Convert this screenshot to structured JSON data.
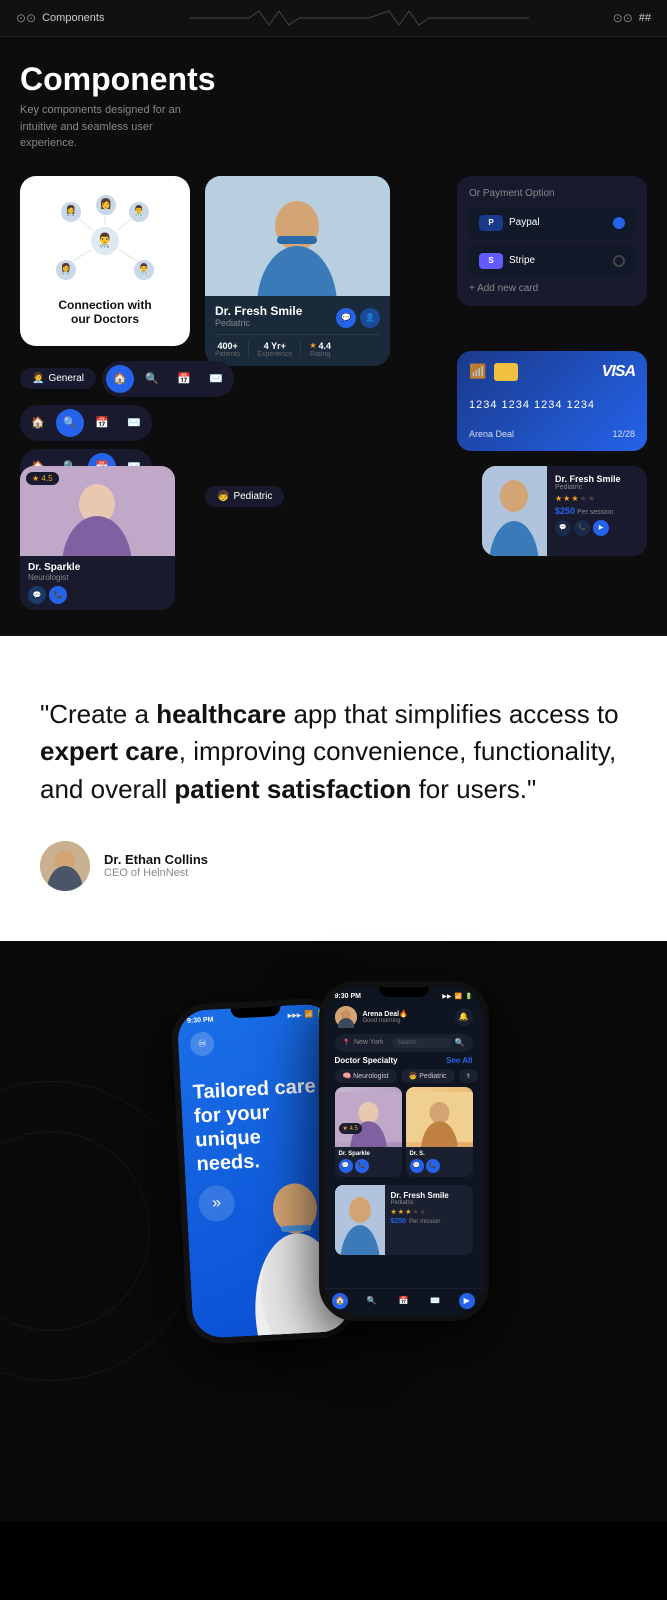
{
  "nav": {
    "title": "Components",
    "hash": "##"
  },
  "header": {
    "title": "Components",
    "subtitle": "Key components designed for an intuitive and seamless user experience."
  },
  "doctor_card": {
    "name": "Dr. Fresh Smile",
    "specialty": "Pediatric",
    "patients": "400+",
    "experience": "4 Yr+",
    "rating": "4.4",
    "patients_label": "Patients",
    "experience_label": "Experience",
    "rating_label": "Rating"
  },
  "payment": {
    "title": "Or Payment Option",
    "options": [
      {
        "name": "Paypal",
        "color": "#1a3a8a",
        "letter": "P",
        "active": true
      },
      {
        "name": "Stripe",
        "color": "#635bff",
        "letter": "S",
        "active": false
      }
    ],
    "add_label": "+ Add new card"
  },
  "visa_card": {
    "number": "1234 1234 1234 1234",
    "holder": "Arena Deal",
    "expiry": "12/28"
  },
  "specialties": {
    "general": "General",
    "neurologist": "Neurologist",
    "pediatric": "Pediatric"
  },
  "dr_sparkle": {
    "name": "Dr. Sparkle",
    "specialty": "Neurologist",
    "rating": "4.5"
  },
  "dr_fresh_mini": {
    "name": "Dr. Fresh Smile",
    "specialty": "Pediatric",
    "price": "$250",
    "per_session": "Per session",
    "stars": 3
  },
  "quote": {
    "open_quote": "“Create a ",
    "bold1": "healthcare",
    "mid1": " app that simplifies access to ",
    "bold2": "expert care",
    "mid2": ", improving convenience, functionality, and overall ",
    "bold3": "patient satisfaction",
    "end": " for users.”"
  },
  "author": {
    "name": "Dr. Ethan Collins",
    "title": "CEO of HelnNest"
  },
  "phone1": {
    "time": "9:30 PM",
    "headline": "Tailored care for your unique needs."
  },
  "phone2": {
    "time": "9:30 PM",
    "user": "Arena Deal🔥",
    "greeting": "Good morning",
    "location": "New York",
    "search_placeholder": "Search",
    "section_doctor_specialty": "Doctor Specialty",
    "see_all": "See All",
    "specialties": [
      "Neurologist",
      "Pediatric"
    ],
    "doctor_name": "Dr. Sparkle",
    "doctor2_name": "Dr. S.",
    "fresh_name": "Dr. Fresh Smile",
    "fresh_specialty": "Pediatric",
    "fresh_price": "$250",
    "fresh_per_session": "Per mission",
    "stars": 3
  },
  "colors": {
    "blue": "#2563eb",
    "dark_bg": "#0f1520",
    "card_bg": "#1a2030",
    "gold": "#f5a623"
  }
}
